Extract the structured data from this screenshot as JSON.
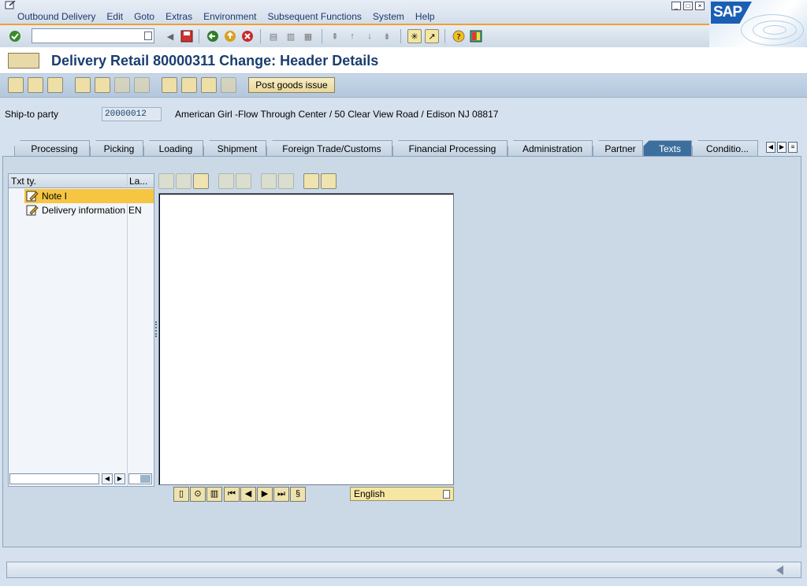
{
  "menu": {
    "items": [
      "Outbound Delivery",
      "Edit",
      "Goto",
      "Extras",
      "Environment",
      "Subsequent Functions",
      "System",
      "Help"
    ]
  },
  "logo": {
    "text": "SAP"
  },
  "command_field": {
    "value": ""
  },
  "title": "Delivery Retail 80000311 Change: Header Details",
  "app_toolbar": {
    "post_goods_issue": "Post goods issue"
  },
  "ship_to": {
    "label": "Ship-to party",
    "value": "20000012",
    "description": "American Girl -Flow Through Center / 50 Clear View Road / Edison NJ 08817"
  },
  "tabs": [
    {
      "label": "Processing",
      "active": false
    },
    {
      "label": "Picking",
      "active": false
    },
    {
      "label": "Loading",
      "active": false
    },
    {
      "label": "Shipment",
      "active": false
    },
    {
      "label": "Foreign Trade/Customs",
      "active": false
    },
    {
      "label": "Financial Processing",
      "active": false
    },
    {
      "label": "Administration",
      "active": false
    },
    {
      "label": "Partner",
      "active": false
    },
    {
      "label": "Texts",
      "active": true
    },
    {
      "label": "Conditio...",
      "active": false
    }
  ],
  "text_tree": {
    "col_text_type": "Txt ty.",
    "col_language": "La...",
    "rows": [
      {
        "label": "Note I",
        "lang": "",
        "selected": true
      },
      {
        "label": "Delivery information",
        "lang": "EN",
        "selected": false
      }
    ]
  },
  "editor": {
    "content": ""
  },
  "language_select": {
    "value": "English"
  },
  "colors": {
    "active_tab": "#3d6f9e",
    "selection": "#f6c542",
    "title": "#1b3e6f",
    "accent_line": "#f0a030"
  }
}
